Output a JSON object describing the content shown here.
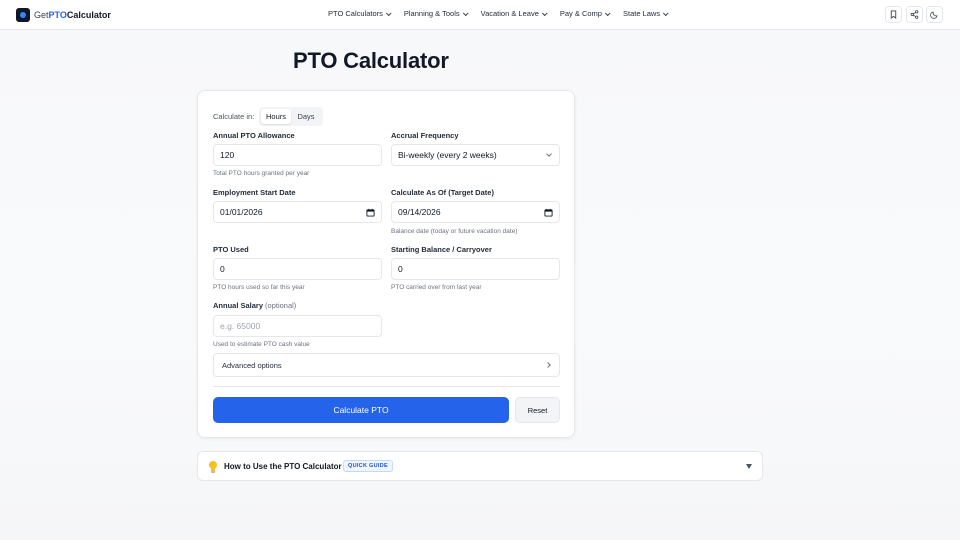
{
  "header": {
    "logo": {
      "pre": "Get",
      "mid": "PTO",
      "post": "Calculator"
    },
    "nav": [
      {
        "label": "PTO Calculators"
      },
      {
        "label": "Planning & Tools"
      },
      {
        "label": "Vacation & Leave"
      },
      {
        "label": "Pay & Comp"
      },
      {
        "label": "State Laws"
      }
    ],
    "icons": [
      "bookmark-icon",
      "share-icon",
      "moon-icon"
    ]
  },
  "page_title": "PTO Calculator",
  "form": {
    "calculate_in_label": "Calculate in:",
    "units": [
      {
        "label": "Hours",
        "active": true
      },
      {
        "label": "Days",
        "active": false
      }
    ],
    "annual_allowance": {
      "label": "Annual PTO Allowance",
      "value": "120",
      "hint": "Total PTO hours granted per year"
    },
    "accrual_frequency": {
      "label": "Accrual Frequency",
      "value": "Bi-weekly (every 2 weeks)"
    },
    "start_date": {
      "label": "Employment Start Date",
      "value": "01/01/2026"
    },
    "target_date": {
      "label": "Calculate As Of (Target Date)",
      "value": "09/14/2026",
      "hint": "Balance date (today or future vacation date)"
    },
    "pto_used": {
      "label": "PTO Used",
      "value": "0",
      "hint": "PTO hours used so far this year"
    },
    "starting_balance": {
      "label": "Starting Balance / Carryover",
      "value": "0",
      "hint": "PTO carried over from last year"
    },
    "salary": {
      "label": "Annual Salary",
      "optional": "(optional)",
      "placeholder": "e.g. 65000",
      "hint": "Used to estimate PTO cash value"
    },
    "advanced": "Advanced options",
    "calculate_button": "Calculate PTO",
    "reset_button": "Reset"
  },
  "guide": {
    "title": "How to Use the PTO Calculator",
    "badge": "QUICK GUIDE"
  },
  "colors": {
    "accent": "#2563eb",
    "text": "#111827",
    "muted": "#6b7280",
    "border": "#e5e7eb"
  }
}
